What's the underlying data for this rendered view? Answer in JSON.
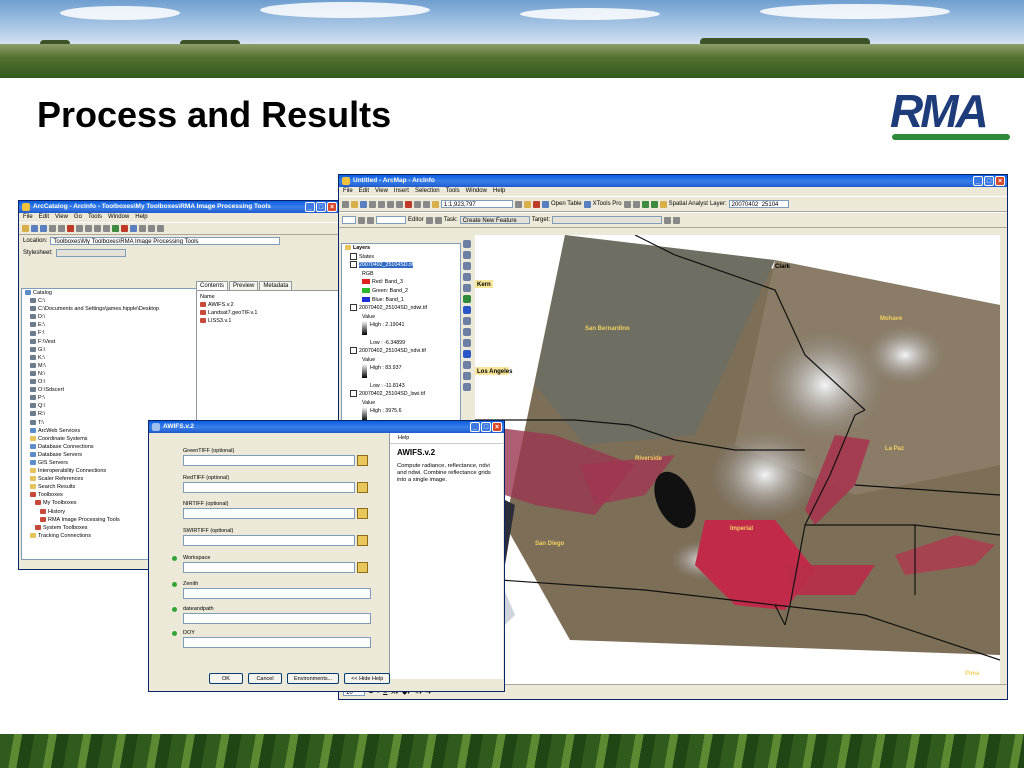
{
  "slide": {
    "title": "Process and Results",
    "logo_text": "RMA"
  },
  "arccatalog": {
    "title": "ArcCatalog - ArcInfo - Toolboxes\\My Toolboxes\\RMA Image Processing Tools",
    "menus": [
      "File",
      "Edit",
      "View",
      "Go",
      "Tools",
      "Window",
      "Help"
    ],
    "location_label": "Location:",
    "location_value": "Toolboxes\\My Toolboxes\\RMA Image Processing Tools",
    "stylesheet_label": "Stylesheet:",
    "stylesheet_value": "",
    "tree": [
      {
        "label": "Catalog",
        "icon": "db"
      },
      {
        "label": "C:\\",
        "icon": "drv"
      },
      {
        "label": "C:\\Documents and Settings\\james.hipple\\Desktop",
        "icon": "drv"
      },
      {
        "label": "D:\\",
        "icon": "drv"
      },
      {
        "label": "E:\\",
        "icon": "drv"
      },
      {
        "label": "F:\\",
        "icon": "drv"
      },
      {
        "label": "F:\\Vest",
        "icon": "drv"
      },
      {
        "label": "G:\\",
        "icon": "drv"
      },
      {
        "label": "K:\\",
        "icon": "drv"
      },
      {
        "label": "M:\\",
        "icon": "drv"
      },
      {
        "label": "N:\\",
        "icon": "drv"
      },
      {
        "label": "O:\\",
        "icon": "drv"
      },
      {
        "label": "O:\\Sdscert",
        "icon": "drv"
      },
      {
        "label": "P:\\",
        "icon": "drv"
      },
      {
        "label": "Q:\\",
        "icon": "drv"
      },
      {
        "label": "R:\\",
        "icon": "drv"
      },
      {
        "label": "T:\\",
        "icon": "drv"
      },
      {
        "label": "ArcWeb Services",
        "icon": "db"
      },
      {
        "label": "Coordinate Systems",
        "icon": "fold"
      },
      {
        "label": "Database Connections",
        "icon": "db"
      },
      {
        "label": "Database Servers",
        "icon": "db"
      },
      {
        "label": "GIS Servers",
        "icon": "db"
      },
      {
        "label": "Interoperability Connections",
        "icon": "fold"
      },
      {
        "label": "Scaler References",
        "icon": "fold"
      },
      {
        "label": "Search Results",
        "icon": "fold"
      },
      {
        "label": "Toolboxes",
        "icon": "tb2"
      },
      {
        "label": "My Toolboxes",
        "icon": "tb2"
      },
      {
        "label": "History",
        "icon": "tb2"
      },
      {
        "label": "RMA Image Processing Tools",
        "icon": "tb2"
      },
      {
        "label": "System Toolboxes",
        "icon": "tb2"
      },
      {
        "label": "Tracking Connections",
        "icon": "fold"
      }
    ],
    "tabs": [
      "Contents",
      "Preview",
      "Metadata"
    ],
    "contents_header": "Name",
    "contents_items": [
      "AWIFS.v.2",
      "Landsat7.geoTIF.v.1",
      "LISS3.v.1"
    ]
  },
  "arcmap": {
    "title": "Untitled - ArcMap - ArcInfo",
    "menus": [
      "File",
      "Edit",
      "View",
      "Insert",
      "Selection",
      "Tools",
      "Window",
      "Help"
    ],
    "scale": "1:1,923,797",
    "open_table": "Open Table",
    "xtools": "XTools Pro",
    "spatial_analyst": "Spatial Analyst",
    "layer_label": "Layer:",
    "layer_value": "20070402_25104",
    "editor": "Editor",
    "task_label": "Task:",
    "task_value": "Create New Feature",
    "target_label": "Target:",
    "toc": {
      "layers": "Layers",
      "states": "States",
      "raster1": "20070402_25104SD.tif",
      "rgb": "RGB",
      "red": "Red:   Band_3",
      "green": "Green: Band_2",
      "blue": "Blue:  Band_1",
      "raster2": "20070402_25104SD_ndwi.tif",
      "value": "Value",
      "high2": "High : 2.19041",
      "low2": "Low : -6.34899",
      "raster3": "20070402_25104SD_ndvi.tif",
      "value3": "Value",
      "high3": "High : 83.937",
      "low3": "Low : -11.8143",
      "raster4": "20070402_25104SD_lswi.tif",
      "value4": "Value",
      "high4": "High : 3975.6"
    },
    "map_labels": [
      "Clark",
      "Kern",
      "San Bernardino",
      "Mohave",
      "Los Angeles",
      "La Paz",
      "Riverside",
      "San Diego",
      "Imperial",
      "Pima"
    ],
    "font_size": "10",
    "colors": {
      "nir_red": "#c22a4a",
      "desert": "#8a7a62",
      "snow": "#e8e8ec"
    }
  },
  "awifs": {
    "title": "AWIFS.v.2",
    "params": [
      {
        "label": "GreenTIFF (optional)",
        "required": false,
        "browse": true
      },
      {
        "label": "RedTIFF (optional)",
        "required": false,
        "browse": true
      },
      {
        "label": "NIRTIFF (optional)",
        "required": false,
        "browse": true
      },
      {
        "label": "SWIRTIFF (optional)",
        "required": false,
        "browse": true
      },
      {
        "label": "Workspace",
        "required": true,
        "browse": true
      },
      {
        "label": "Zenith",
        "required": true,
        "browse": false
      },
      {
        "label": "dateandpath",
        "required": true,
        "browse": false
      },
      {
        "label": "DOY",
        "required": true,
        "browse": false
      }
    ],
    "buttons": [
      "OK",
      "Cancel",
      "Environments...",
      "<< Hide Help"
    ],
    "help_tab": "Help",
    "help_title": "AWIFS.v.2",
    "help_text": "Compute radiance, reflectance, ndvi and ndwi. Combine reflectance grids into a single image."
  }
}
